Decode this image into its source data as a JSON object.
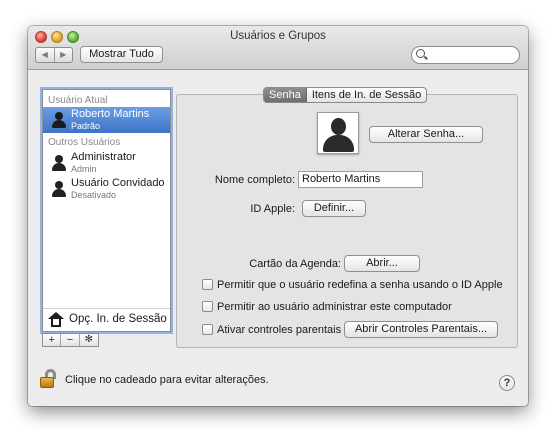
{
  "window": {
    "title": "Usuários e Grupos"
  },
  "toolbar": {
    "back_glyph": "◀",
    "forward_glyph": "▶",
    "show_all_label": "Mostrar Tudo",
    "search_placeholder": ""
  },
  "sidebar": {
    "current_user_header": "Usuário Atual",
    "current_user": {
      "name": "Roberto Martins",
      "role": "Padrão"
    },
    "other_users_header": "Outros Usuários",
    "other_users": [
      {
        "name": "Administrator",
        "role": "Admin"
      },
      {
        "name": "Usuário Convidado",
        "role": "Desativado"
      }
    ],
    "login_options_label": "Opç. In. de Sessão",
    "add_glyph": "+",
    "remove_glyph": "−",
    "actions_glyph": "✻"
  },
  "tabs": [
    {
      "label": "Senha",
      "active": true
    },
    {
      "label": "Itens de In. de Sessão",
      "active": false
    }
  ],
  "password_pane": {
    "change_password_label": "Alterar Senha...",
    "full_name_label": "Nome completo:",
    "full_name_value": "Roberto Martins",
    "apple_id_label": "ID Apple:",
    "apple_id_button": "Definir...",
    "address_card_label": "Cartão da Agenda:",
    "address_card_button": "Abrir...",
    "checkboxes": [
      {
        "label": "Permitir que o usuário redefina a senha usando o ID Apple",
        "checked": false
      },
      {
        "label": "Permitir ao usuário administrar este computador",
        "checked": false
      },
      {
        "label": "Ativar controles parentais",
        "checked": false
      }
    ],
    "parental_controls_button": "Abrir Controles Parentais..."
  },
  "footer": {
    "lock_text": "Clique no cadeado para evitar alterações.",
    "help_glyph": "?"
  },
  "colors": {
    "selection": "#3e74c9",
    "focus_ring": "#8fb4e4",
    "window_bg": "#ececec"
  },
  "icons": [
    "close-icon",
    "minimize-icon",
    "zoom-icon",
    "back-icon",
    "forward-icon",
    "search-icon",
    "user-icon",
    "house-icon",
    "lock-icon",
    "help-icon"
  ]
}
